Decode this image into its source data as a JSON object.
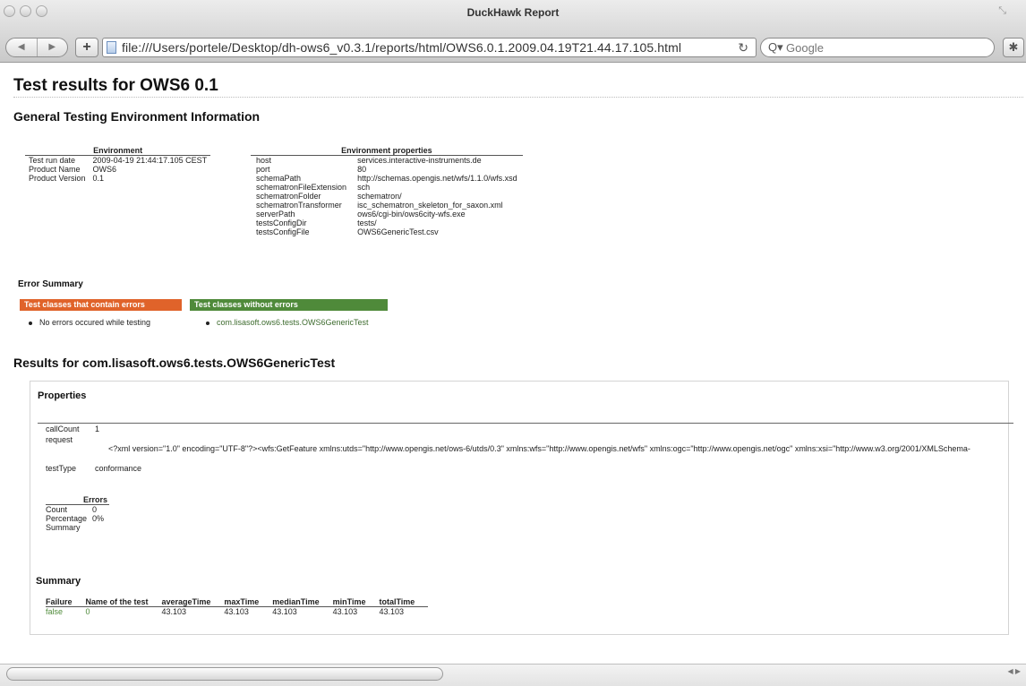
{
  "window": {
    "title": "DuckHawk Report"
  },
  "toolbar": {
    "back": "◀",
    "forward": "▶",
    "add": "+",
    "url": "file:///Users/portele/Desktop/dh-ows6_v0.3.1/reports/html/OWS6.0.1.2009.04.19T21.44.17.105.html",
    "reload": "↻",
    "search_placeholder": "Google",
    "search_icon": "Q▾"
  },
  "page": {
    "title": "Test results for OWS6 0.1",
    "general_heading": "General Testing Environment Information",
    "environment": {
      "header": "Environment",
      "rows": [
        {
          "label": "Test run date",
          "value": "2009-04-19 21:44:17.105 CEST"
        },
        {
          "label": "Product Name",
          "value": "OWS6"
        },
        {
          "label": "Product Version",
          "value": "0.1"
        }
      ]
    },
    "env_properties": {
      "header": "Environment properties",
      "rows": [
        {
          "label": "host",
          "value": "services.interactive-instruments.de"
        },
        {
          "label": "port",
          "value": "80"
        },
        {
          "label": "schemaPath",
          "value": "http://schemas.opengis.net/wfs/1.1.0/wfs.xsd"
        },
        {
          "label": "schematronFileExtension",
          "value": "sch"
        },
        {
          "label": "schematronFolder",
          "value": "schematron/"
        },
        {
          "label": "schematronTransformer",
          "value": "isc_schematron_skeleton_for_saxon.xml"
        },
        {
          "label": "serverPath",
          "value": "ows6/cgi-bin/ows6city-wfs.exe"
        },
        {
          "label": "testsConfigDir",
          "value": "tests/"
        },
        {
          "label": "testsConfigFile",
          "value": "OWS6GenericTest.csv"
        }
      ]
    },
    "error_summary": {
      "title": "Error Summary",
      "with_errors_label": "Test classes that contain errors",
      "without_errors_label": "Test classes without errors",
      "with_errors_item": "No errors occured while testing",
      "without_errors_item": "com.lisasoft.ows6.tests.OWS6GenericTest",
      "error_color": "#e0632a",
      "ok_color": "#4f8a3a"
    },
    "results_heading": "Results for com.lisasoft.ows6.tests.OWS6GenericTest",
    "properties": {
      "title": "Properties",
      "callcount_label": "callCount",
      "callcount_value": "1",
      "request_label": "request",
      "request_value": "<?xml version=\"1.0\" encoding=\"UTF-8\"?><wfs:GetFeature xmlns:utds=\"http://www.opengis.net/ows-6/utds/0.3\" xmlns:wfs=\"http://www.opengis.net/wfs\" xmlns:ogc=\"http://www.opengis.net/ogc\" xmlns:xsi=\"http://www.w3.org/2001/XMLSchema-",
      "testtype_label": "testType",
      "testtype_value": "conformance"
    },
    "errors": {
      "header": "Errors",
      "rows": [
        {
          "label": "Count",
          "value": "0"
        },
        {
          "label": "Percentage",
          "value": "0%"
        },
        {
          "label": "Summary",
          "value": ""
        }
      ]
    },
    "summary": {
      "title": "Summary",
      "columns": [
        "Failure",
        "Name of the test",
        "averageTime",
        "maxTime",
        "medianTime",
        "minTime",
        "totalTime"
      ],
      "row": [
        "false",
        "0",
        "43.103",
        "43.103",
        "43.103",
        "43.103",
        "43.103"
      ]
    }
  }
}
